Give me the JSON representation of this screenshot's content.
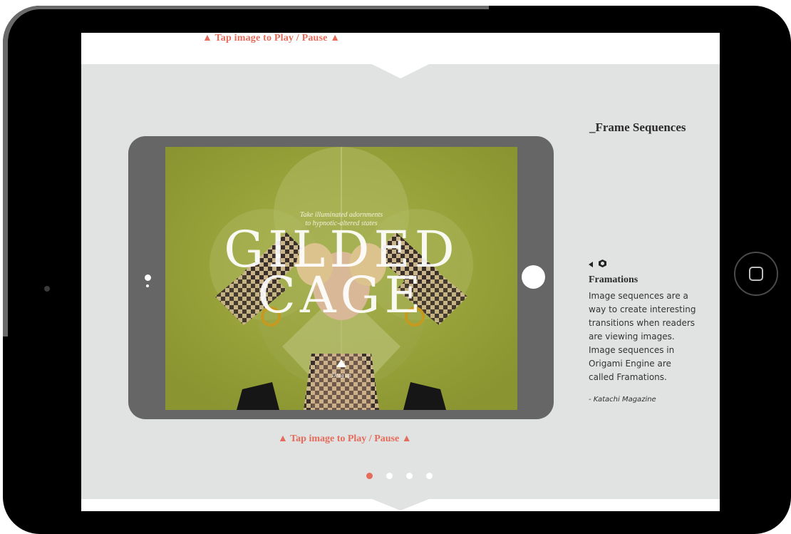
{
  "captions": {
    "top": "▲ Tap image to Play / Pause ▲",
    "bottom": "▲ Tap image to Play / Pause ▲"
  },
  "sidebar": {
    "section_title": "_Frame Sequences",
    "heading": "Framations",
    "body_lines": [
      "Image sequences are  a",
      "way to create interesting",
      "transitions when readers",
      "are viewing images.",
      "Image sequences in",
      "Origami Engine are",
      "called Framations."
    ],
    "source": "- Katachi Magazine",
    "icons": [
      "back-arrow-icon",
      "origami-logo-icon"
    ]
  },
  "preview": {
    "tagline_line1": "Take illuminated adornments",
    "tagline_line2": "to hypnotic-altered states",
    "title_line1": "GILDED",
    "title_line2": "CAGE",
    "drag_label": "Drag up"
  },
  "pager": {
    "count": 4,
    "active_index": 0,
    "active_color": "#e56b5a",
    "inactive_color": "#ffffff"
  },
  "colors": {
    "accent": "#e56b5a",
    "panel": "#e1e2e2",
    "device_frame": "#000000",
    "inner_device": "#666666",
    "image_background": "#9aa43a"
  }
}
